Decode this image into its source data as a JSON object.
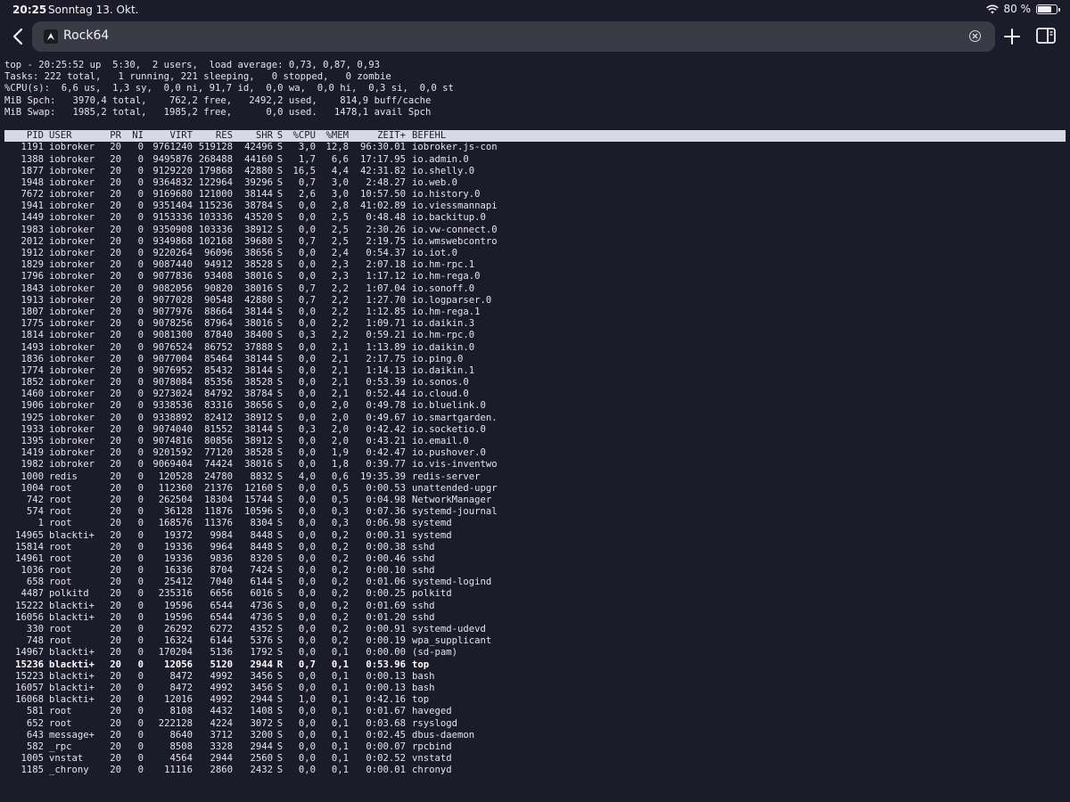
{
  "status_bar": {
    "time": "20:25",
    "date": "Sonntag 13. Okt.",
    "battery": "80 %",
    "battery_level": 0.8
  },
  "browser": {
    "site_title": "Rock64",
    "back_icon": "chevron-left-icon",
    "clear_icon": "clear-x-icon",
    "new_tab_icon": "plus-icon",
    "sidebar_icon": "sidebar-icon"
  },
  "top": {
    "summary": [
      "top - 20:25:52 up  5:30,  2 users,  load average: 0,73, 0,87, 0,93",
      "Tasks: 222 total,   1 running, 221 sleeping,   0 stopped,   0 zombie",
      "%CPU(s):  6,6 us,  1,3 sy,  0,0 ni, 91,7 id,  0,0 wa,  0,0 hi,  0,3 si,  0,0 st",
      "MiB Spch:   3970,4 total,    762,2 free,   2492,2 used,    814,9 buff/cache",
      "MiB Swap:   1985,2 total,   1985,2 free,      0,0 used.   1478,1 avail Spch"
    ],
    "columns": [
      "PID",
      "USER",
      "PR",
      "NI",
      "VIRT",
      "RES",
      "SHR",
      "S",
      "%CPU",
      "%MEM",
      "ZEIT+",
      "BEFEHL"
    ],
    "highlight_row": 44,
    "processes": [
      [
        "1191",
        "iobroker",
        "20",
        "0",
        "9761240",
        "519128",
        "42496",
        "S",
        "3,0",
        "12,8",
        "96:30.01",
        "iobroker.js-con"
      ],
      [
        "1388",
        "iobroker",
        "20",
        "0",
        "9495876",
        "268488",
        "44160",
        "S",
        "1,7",
        "6,6",
        "17:17.95",
        "io.admin.0"
      ],
      [
        "1877",
        "iobroker",
        "20",
        "0",
        "9129220",
        "179868",
        "42880",
        "S",
        "16,5",
        "4,4",
        "42:31.82",
        "io.shelly.0"
      ],
      [
        "1948",
        "iobroker",
        "20",
        "0",
        "9364832",
        "122964",
        "39296",
        "S",
        "0,7",
        "3,0",
        "2:48.27",
        "io.web.0"
      ],
      [
        "7672",
        "iobroker",
        "20",
        "0",
        "9169680",
        "121000",
        "38144",
        "S",
        "2,6",
        "3,0",
        "10:57.50",
        "io.history.0"
      ],
      [
        "1941",
        "iobroker",
        "20",
        "0",
        "9351404",
        "115236",
        "38784",
        "S",
        "0,0",
        "2,8",
        "41:02.89",
        "io.viessmannapi"
      ],
      [
        "1449",
        "iobroker",
        "20",
        "0",
        "9153336",
        "103336",
        "43520",
        "S",
        "0,0",
        "2,5",
        "0:48.48",
        "io.backitup.0"
      ],
      [
        "1983",
        "iobroker",
        "20",
        "0",
        "9350908",
        "103336",
        "38912",
        "S",
        "0,0",
        "2,5",
        "2:30.26",
        "io.vw-connect.0"
      ],
      [
        "2012",
        "iobroker",
        "20",
        "0",
        "9349868",
        "102168",
        "39680",
        "S",
        "0,7",
        "2,5",
        "2:19.75",
        "io.wmswebcontro"
      ],
      [
        "1912",
        "iobroker",
        "20",
        "0",
        "9220264",
        "96096",
        "38656",
        "S",
        "0,0",
        "2,4",
        "0:54.37",
        "io.iot.0"
      ],
      [
        "1829",
        "iobroker",
        "20",
        "0",
        "9087440",
        "94912",
        "38528",
        "S",
        "0,0",
        "2,3",
        "2:07.18",
        "io.hm-rpc.1"
      ],
      [
        "1796",
        "iobroker",
        "20",
        "0",
        "9077836",
        "93408",
        "38016",
        "S",
        "0,0",
        "2,3",
        "1:17.12",
        "io.hm-rega.0"
      ],
      [
        "1843",
        "iobroker",
        "20",
        "0",
        "9082056",
        "90820",
        "38016",
        "S",
        "0,7",
        "2,2",
        "1:07.04",
        "io.sonoff.0"
      ],
      [
        "1913",
        "iobroker",
        "20",
        "0",
        "9077028",
        "90548",
        "42880",
        "S",
        "0,7",
        "2,2",
        "1:27.70",
        "io.logparser.0"
      ],
      [
        "1807",
        "iobroker",
        "20",
        "0",
        "9077976",
        "88664",
        "38144",
        "S",
        "0,0",
        "2,2",
        "1:12.85",
        "io.hm-rega.1"
      ],
      [
        "1775",
        "iobroker",
        "20",
        "0",
        "9078256",
        "87964",
        "38016",
        "S",
        "0,0",
        "2,2",
        "1:09.71",
        "io.daikin.3"
      ],
      [
        "1814",
        "iobroker",
        "20",
        "0",
        "9081300",
        "87840",
        "38400",
        "S",
        "0,3",
        "2,2",
        "0:59.21",
        "io.hm-rpc.0"
      ],
      [
        "1493",
        "iobroker",
        "20",
        "0",
        "9076524",
        "86752",
        "37888",
        "S",
        "0,0",
        "2,1",
        "1:13.89",
        "io.daikin.0"
      ],
      [
        "1836",
        "iobroker",
        "20",
        "0",
        "9077004",
        "85464",
        "38144",
        "S",
        "0,0",
        "2,1",
        "2:17.75",
        "io.ping.0"
      ],
      [
        "1774",
        "iobroker",
        "20",
        "0",
        "9076952",
        "85432",
        "38144",
        "S",
        "0,0",
        "2,1",
        "1:14.13",
        "io.daikin.1"
      ],
      [
        "1852",
        "iobroker",
        "20",
        "0",
        "9078084",
        "85356",
        "38528",
        "S",
        "0,0",
        "2,1",
        "0:53.39",
        "io.sonos.0"
      ],
      [
        "1460",
        "iobroker",
        "20",
        "0",
        "9273024",
        "84792",
        "38784",
        "S",
        "0,0",
        "2,1",
        "0:52.44",
        "io.cloud.0"
      ],
      [
        "1906",
        "iobroker",
        "20",
        "0",
        "9338536",
        "83316",
        "38656",
        "S",
        "0,0",
        "2,0",
        "0:49.78",
        "io.bluelink.0"
      ],
      [
        "1925",
        "iobroker",
        "20",
        "0",
        "9338892",
        "82412",
        "38912",
        "S",
        "0,0",
        "2,0",
        "0:49.67",
        "io.smartgarden."
      ],
      [
        "1933",
        "iobroker",
        "20",
        "0",
        "9074040",
        "81552",
        "38144",
        "S",
        "0,3",
        "2,0",
        "0:42.42",
        "io.socketio.0"
      ],
      [
        "1395",
        "iobroker",
        "20",
        "0",
        "9074816",
        "80856",
        "38912",
        "S",
        "0,0",
        "2,0",
        "0:43.21",
        "io.email.0"
      ],
      [
        "1419",
        "iobroker",
        "20",
        "0",
        "9201592",
        "77120",
        "38528",
        "S",
        "0,0",
        "1,9",
        "0:42.47",
        "io.pushover.0"
      ],
      [
        "1982",
        "iobroker",
        "20",
        "0",
        "9069404",
        "74424",
        "38016",
        "S",
        "0,0",
        "1,8",
        "0:39.77",
        "io.vis-inventwo"
      ],
      [
        "1000",
        "redis",
        "20",
        "0",
        "120528",
        "24780",
        "8832",
        "S",
        "4,0",
        "0,6",
        "19:35.39",
        "redis-server"
      ],
      [
        "1004",
        "root",
        "20",
        "0",
        "112360",
        "21376",
        "12160",
        "S",
        "0,0",
        "0,5",
        "0:00.53",
        "unattended-upgr"
      ],
      [
        "742",
        "root",
        "20",
        "0",
        "262504",
        "18304",
        "15744",
        "S",
        "0,0",
        "0,5",
        "0:04.98",
        "NetworkManager"
      ],
      [
        "574",
        "root",
        "20",
        "0",
        "36128",
        "11876",
        "10596",
        "S",
        "0,0",
        "0,3",
        "0:07.36",
        "systemd-journal"
      ],
      [
        "1",
        "root",
        "20",
        "0",
        "168576",
        "11376",
        "8304",
        "S",
        "0,0",
        "0,3",
        "0:06.98",
        "systemd"
      ],
      [
        "14965",
        "blackti+",
        "20",
        "0",
        "19372",
        "9984",
        "8448",
        "S",
        "0,0",
        "0,2",
        "0:00.31",
        "systemd"
      ],
      [
        "15814",
        "root",
        "20",
        "0",
        "19336",
        "9964",
        "8448",
        "S",
        "0,0",
        "0,2",
        "0:00.38",
        "sshd"
      ],
      [
        "14961",
        "root",
        "20",
        "0",
        "19336",
        "9836",
        "8320",
        "S",
        "0,0",
        "0,2",
        "0:00.46",
        "sshd"
      ],
      [
        "1036",
        "root",
        "20",
        "0",
        "16336",
        "8704",
        "7424",
        "S",
        "0,0",
        "0,2",
        "0:00.10",
        "sshd"
      ],
      [
        "658",
        "root",
        "20",
        "0",
        "25412",
        "7040",
        "6144",
        "S",
        "0,0",
        "0,2",
        "0:01.06",
        "systemd-logind"
      ],
      [
        "4487",
        "polkitd",
        "20",
        "0",
        "235316",
        "6656",
        "6016",
        "S",
        "0,0",
        "0,2",
        "0:00.25",
        "polkitd"
      ],
      [
        "15222",
        "blackti+",
        "20",
        "0",
        "19596",
        "6544",
        "4736",
        "S",
        "0,0",
        "0,2",
        "0:01.69",
        "sshd"
      ],
      [
        "16056",
        "blackti+",
        "20",
        "0",
        "19596",
        "6544",
        "4736",
        "S",
        "0,0",
        "0,2",
        "0:01.20",
        "sshd"
      ],
      [
        "330",
        "root",
        "20",
        "0",
        "26292",
        "6272",
        "4352",
        "S",
        "0,0",
        "0,2",
        "0:00.91",
        "systemd-udevd"
      ],
      [
        "748",
        "root",
        "20",
        "0",
        "16324",
        "6144",
        "5376",
        "S",
        "0,0",
        "0,2",
        "0:00.19",
        "wpa_supplicant"
      ],
      [
        "14967",
        "blackti+",
        "20",
        "0",
        "170204",
        "5136",
        "1792",
        "S",
        "0,0",
        "0,1",
        "0:00.00",
        "(sd-pam)"
      ],
      [
        "15236",
        "blackti+",
        "20",
        "0",
        "12056",
        "5120",
        "2944",
        "R",
        "0,7",
        "0,1",
        "0:53.96",
        "top"
      ],
      [
        "15223",
        "blackti+",
        "20",
        "0",
        "8472",
        "4992",
        "3456",
        "S",
        "0,0",
        "0,1",
        "0:00.13",
        "bash"
      ],
      [
        "16057",
        "blackti+",
        "20",
        "0",
        "8472",
        "4992",
        "3456",
        "S",
        "0,0",
        "0,1",
        "0:00.13",
        "bash"
      ],
      [
        "16068",
        "blackti+",
        "20",
        "0",
        "12016",
        "4992",
        "2944",
        "S",
        "1,0",
        "0,1",
        "0:42.16",
        "top"
      ],
      [
        "581",
        "root",
        "20",
        "0",
        "8108",
        "4432",
        "1408",
        "S",
        "0,0",
        "0,1",
        "0:01.67",
        "haveged"
      ],
      [
        "652",
        "root",
        "20",
        "0",
        "222128",
        "4224",
        "3072",
        "S",
        "0,0",
        "0,1",
        "0:03.68",
        "rsyslogd"
      ],
      [
        "643",
        "message+",
        "20",
        "0",
        "8640",
        "3712",
        "3200",
        "S",
        "0,0",
        "0,1",
        "0:02.45",
        "dbus-daemon"
      ],
      [
        "582",
        "_rpc",
        "20",
        "0",
        "8508",
        "3328",
        "2944",
        "S",
        "0,0",
        "0,1",
        "0:00.07",
        "rpcbind"
      ],
      [
        "1005",
        "vnstat",
        "20",
        "0",
        "4564",
        "2944",
        "2560",
        "S",
        "0,0",
        "0,1",
        "0:02.52",
        "vnstatd"
      ],
      [
        "1185",
        "_chrony",
        "20",
        "0",
        "11116",
        "2860",
        "2432",
        "S",
        "0,0",
        "0,1",
        "0:00.01",
        "chronyd"
      ]
    ]
  }
}
